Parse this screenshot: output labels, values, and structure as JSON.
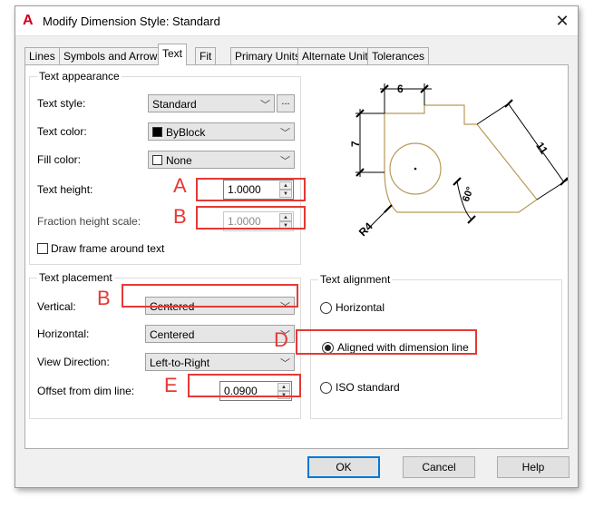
{
  "window": {
    "app_logo": "A",
    "title": "Modify Dimension Style: Standard",
    "close_glyph": "✕"
  },
  "tabs": [
    {
      "label": "Lines"
    },
    {
      "label": "Symbols and Arrows"
    },
    {
      "label": "Text",
      "active": true
    },
    {
      "label": "Fit"
    },
    {
      "label": "Primary Units"
    },
    {
      "label": "Alternate Units"
    },
    {
      "label": "Tolerances"
    }
  ],
  "text_appearance": {
    "title": "Text appearance",
    "text_style_label": "Text style:",
    "text_style_value": "Standard",
    "text_style_more": "...",
    "text_color_label": "Text color:",
    "text_color_value": "ByBlock",
    "fill_color_label": "Fill color:",
    "fill_color_value": "None",
    "text_height_label": "Text height:",
    "text_height_value": "1.0000",
    "fraction_height_label": "Fraction height scale:",
    "fraction_height_value": "1.0000",
    "draw_frame_label": "Draw frame around text",
    "draw_frame_checked": false
  },
  "text_placement": {
    "title": "Text placement",
    "vertical_label": "Vertical:",
    "vertical_value": "Centered",
    "horizontal_label": "Horizontal:",
    "horizontal_value": "Centered",
    "view_direction_label": "View Direction:",
    "view_direction_value": "Left-to-Right",
    "offset_label": "Offset from dim line:",
    "offset_value": "0.0900"
  },
  "text_alignment": {
    "title": "Text alignment",
    "options": [
      {
        "label": "Horizontal",
        "selected": false
      },
      {
        "label": "Aligned with dimension line",
        "selected": true
      },
      {
        "label": "ISO standard",
        "selected": false
      }
    ]
  },
  "preview": {
    "dim_top": "6",
    "dim_left": "7",
    "dim_right": "11",
    "dim_angle": "60°",
    "dim_radius": "R4"
  },
  "annotations": {
    "a": "A",
    "b1": "B",
    "b2": "B",
    "d": "D",
    "e": "E",
    "color": "#e53935"
  },
  "buttons": {
    "ok": "OK",
    "cancel": "Cancel",
    "help": "Help"
  }
}
